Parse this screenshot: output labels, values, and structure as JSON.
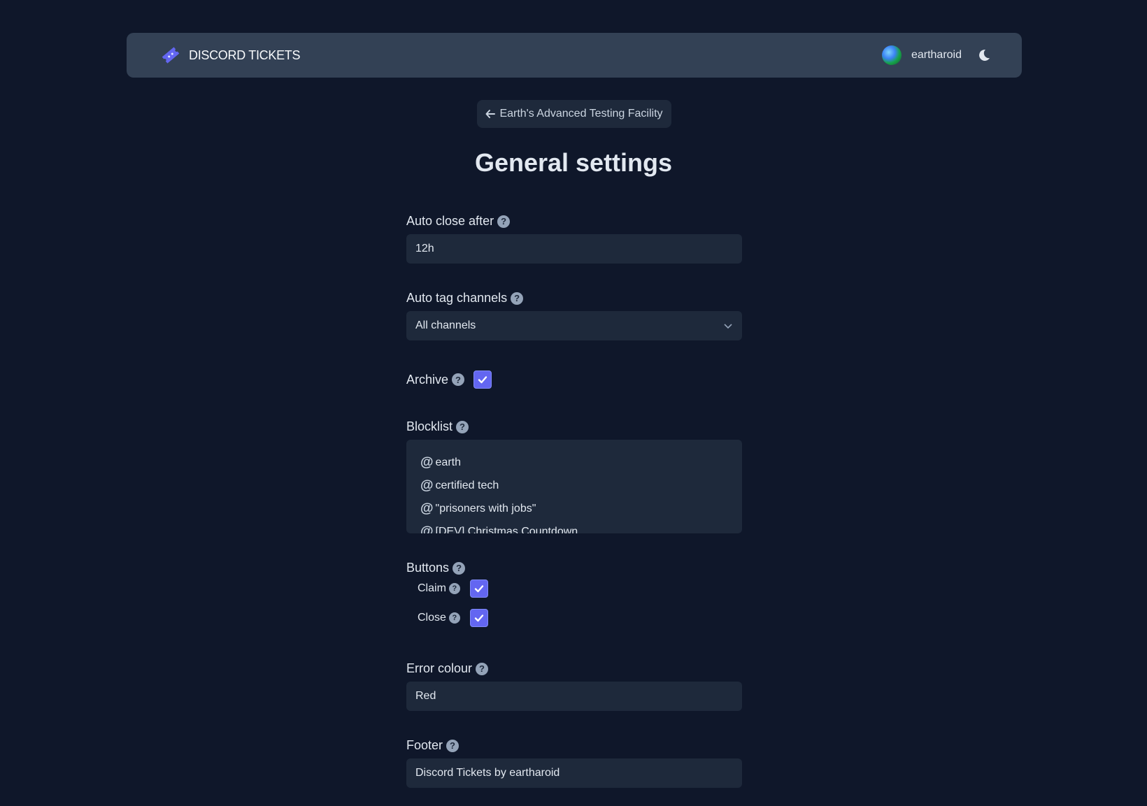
{
  "navbar": {
    "brand_name": "DISCORD TICKETS",
    "username": "eartharoid",
    "icons": {
      "logo": "ticket-logo-icon",
      "avatar": "globe-avatar",
      "theme_toggle": "moon-icon"
    },
    "accent": "#6366f1"
  },
  "back_link": {
    "label": "Earth's Advanced Testing Facility",
    "icon": "arrow-left-icon"
  },
  "page_title": "General settings",
  "fields": {
    "auto_close": {
      "label": "Auto close after",
      "value": "12h"
    },
    "auto_tag": {
      "label": "Auto tag channels",
      "value": "All channels"
    },
    "archive": {
      "label": "Archive",
      "checked": true
    },
    "blocklist": {
      "label": "Blocklist",
      "items": [
        "earth",
        "certified tech",
        "\"prisoners with jobs\"",
        "[DEV] Christmas Countdown"
      ]
    },
    "buttons": {
      "label": "Buttons",
      "claim": {
        "label": "Claim",
        "checked": true
      },
      "close": {
        "label": "Close",
        "checked": true
      }
    },
    "error_colour": {
      "label": "Error colour",
      "value": "Red"
    },
    "footer": {
      "label": "Footer",
      "value": "Discord Tickets by eartharoid"
    }
  },
  "help_glyph": "?"
}
